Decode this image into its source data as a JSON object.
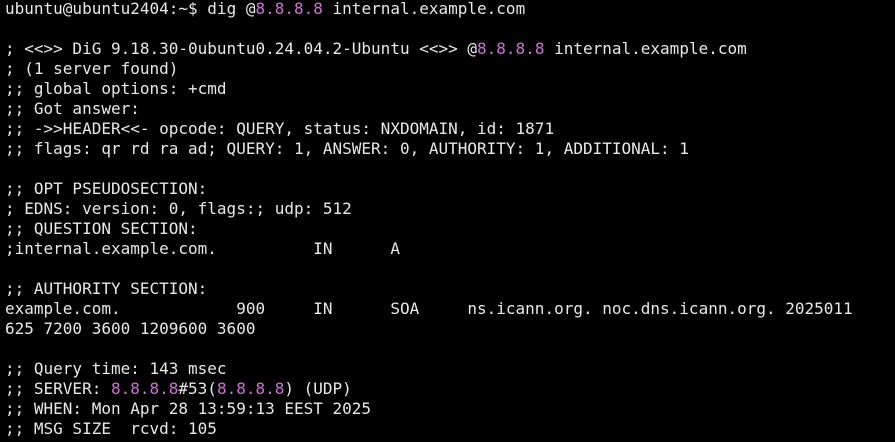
{
  "terminal": {
    "prompt": "ubuntu@ubuntu2404:~$ ",
    "cmd_pre": "dig @",
    "server_ip": "8.8.8.8",
    "cmd_post": " internal.example.com",
    "banner_pre": "; <<>> DiG 9.18.30-0ubuntu0.24.04.2-Ubuntu <<>> @",
    "banner_ip": "8.8.8.8",
    "banner_post": " internal.example.com",
    "server_found": "; (1 server found)",
    "global_options": ";; global options: +cmd",
    "got_answer": ";; Got answer:",
    "header": ";; ->>HEADER<<- opcode: QUERY, status: NXDOMAIN, id: 1871",
    "flags": ";; flags: qr rd ra ad; QUERY: 1, ANSWER: 0, AUTHORITY: 1, ADDITIONAL: 1",
    "opt_section": ";; OPT PSEUDOSECTION:",
    "edns": "; EDNS: version: 0, flags:; udp: 512",
    "question_section": ";; QUESTION SECTION:",
    "question_record": ";internal.example.com.          IN      A",
    "authority_section": ";; AUTHORITY SECTION:",
    "authority_record_1": "example.com.            900     IN      SOA     ns.icann.org. noc.dns.icann.org. 2025011",
    "authority_record_2": "625 7200 3600 1209600 3600",
    "query_time": ";; Query time: 143 msec",
    "server_pre": ";; SERVER: ",
    "server_ip1": "8.8.8.8",
    "server_mid": "#53(",
    "server_ip2": "8.8.8.8",
    "server_post": ") (UDP)",
    "when": ";; WHEN: Mon Apr 28 13:59:13 EEST 2025",
    "msg_size": ";; MSG SIZE  rcvd: 105"
  },
  "colors": {
    "background": "#000000",
    "text": "#e8e8e8",
    "ip_highlight": "#d070d8"
  }
}
